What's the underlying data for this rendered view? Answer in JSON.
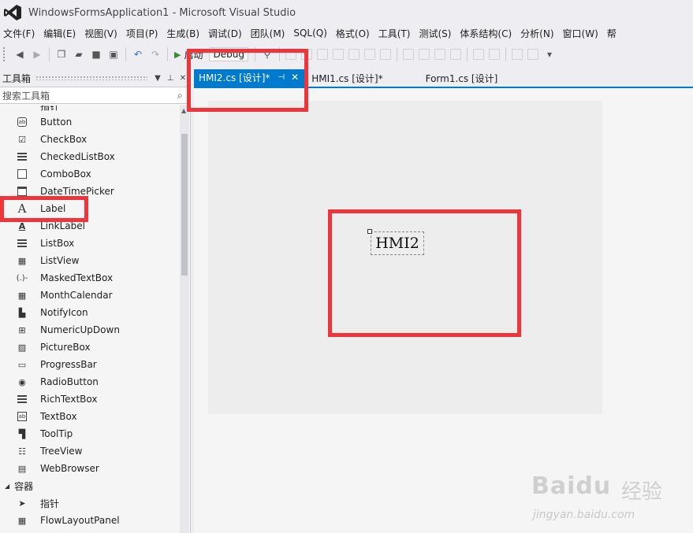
{
  "window": {
    "title": "WindowsFormsApplication1 - Microsoft Visual Studio"
  },
  "menu": [
    "文件(F)",
    "编辑(E)",
    "视图(V)",
    "项目(P)",
    "生成(B)",
    "调试(D)",
    "团队(M)",
    "SQL(Q)",
    "格式(O)",
    "工具(T)",
    "测试(S)",
    "体系结构(C)",
    "分析(N)",
    "窗口(W)",
    "帮"
  ],
  "toolbar": {
    "start_label": "启动",
    "config_value": "Debug"
  },
  "toolbox": {
    "title": "工具箱",
    "search_placeholder": "搜索工具箱",
    "partial_top_item": "指针",
    "items": [
      {
        "label": "Button",
        "icon": "button-icon"
      },
      {
        "label": "CheckBox",
        "icon": "checkbox-icon"
      },
      {
        "label": "CheckedListBox",
        "icon": "checkedlistbox-icon"
      },
      {
        "label": "ComboBox",
        "icon": "combobox-icon"
      },
      {
        "label": "DateTimePicker",
        "icon": "datetimepicker-icon"
      },
      {
        "label": "Label",
        "icon": "label-icon"
      },
      {
        "label": "LinkLabel",
        "icon": "linklabel-icon"
      },
      {
        "label": "ListBox",
        "icon": "listbox-icon"
      },
      {
        "label": "ListView",
        "icon": "listview-icon"
      },
      {
        "label": "MaskedTextBox",
        "icon": "maskedtextbox-icon"
      },
      {
        "label": "MonthCalendar",
        "icon": "monthcalendar-icon"
      },
      {
        "label": "NotifyIcon",
        "icon": "notifyicon-icon"
      },
      {
        "label": "NumericUpDown",
        "icon": "numericupdown-icon"
      },
      {
        "label": "PictureBox",
        "icon": "picturebox-icon"
      },
      {
        "label": "ProgressBar",
        "icon": "progressbar-icon"
      },
      {
        "label": "RadioButton",
        "icon": "radiobutton-icon"
      },
      {
        "label": "RichTextBox",
        "icon": "richtextbox-icon"
      },
      {
        "label": "TextBox",
        "icon": "textbox-icon"
      },
      {
        "label": "ToolTip",
        "icon": "tooltip-icon"
      },
      {
        "label": "TreeView",
        "icon": "treeview-icon"
      },
      {
        "label": "WebBrowser",
        "icon": "webbrowser-icon"
      }
    ],
    "group_containers": "容器",
    "container_items": [
      {
        "label": "指针",
        "icon": "pointer-icon"
      },
      {
        "label": "FlowLayoutPanel",
        "icon": "flowlayoutpanel-icon"
      }
    ]
  },
  "tabs": [
    {
      "label": "HMI2.cs [设计]*",
      "active": true
    },
    {
      "label": "HMI1.cs [设计]*",
      "active": false
    },
    {
      "label": "Form1.cs [设计]",
      "active": false
    }
  ],
  "designer": {
    "label_text": "HMI2"
  },
  "watermark": {
    "brand": "Baidu",
    "cn": "经验",
    "url": "jingyan.baidu.com"
  },
  "colors": {
    "accent": "#007acc",
    "annotation": "#f0353a"
  }
}
